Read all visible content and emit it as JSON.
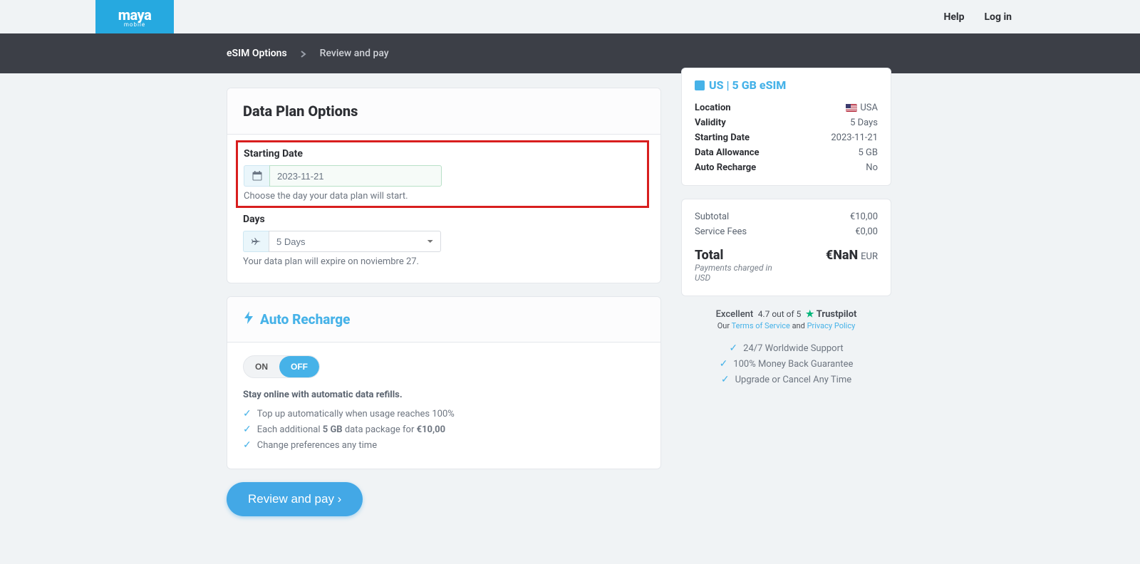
{
  "header": {
    "logo_main": "maya",
    "logo_sub": "mobile",
    "nav": {
      "help": "Help",
      "login": "Log in"
    }
  },
  "breadcrumb": {
    "step1": "eSIM Options",
    "step2": "Review and pay"
  },
  "data_plan": {
    "title": "Data Plan Options",
    "starting_date_label": "Starting Date",
    "starting_date_value": "2023-11-21",
    "starting_date_helper": "Choose the day your data plan will start.",
    "days_label": "Days",
    "days_value": "5 Days",
    "days_helper": "Your data plan will expire on noviembre 27."
  },
  "auto_recharge": {
    "title": "Auto Recharge",
    "on": "ON",
    "off": "OFF",
    "headline": "Stay online with automatic data refills.",
    "b1": "Top up automatically when usage reaches 100%",
    "b2a": "Each additional ",
    "b2b": "5 GB",
    "b2c": " data package for ",
    "b2d": "€10,00",
    "b3": "Change preferences any time"
  },
  "cta": {
    "review": "Review and pay ›"
  },
  "summary": {
    "title": "US | 5 GB eSIM",
    "rows": {
      "location_k": "Location",
      "location_v": "USA",
      "validity_k": "Validity",
      "validity_v": "5 Days",
      "start_k": "Starting Date",
      "start_v": "2023-11-21",
      "allowance_k": "Data Allowance",
      "allowance_v": "5 GB",
      "auto_k": "Auto Recharge",
      "auto_v": "No"
    }
  },
  "totals": {
    "subtotal_k": "Subtotal",
    "subtotal_v": "€10,00",
    "fees_k": "Service Fees",
    "fees_v": "€0,00",
    "total_k": "Total",
    "total_v": "€NaN",
    "currency": "EUR",
    "note": "Payments charged in USD"
  },
  "trust": {
    "excellent": "Excellent",
    "rating": "4.7 out of 5",
    "trustpilot": "Trustpilot",
    "our": "Our ",
    "tos": "Terms of Service",
    "and": " and ",
    "privacy": "Privacy Policy"
  },
  "perks": {
    "p1": "24/7 Worldwide Support",
    "p2": "100% Money Back Guarantee",
    "p3": "Upgrade or Cancel Any Time"
  }
}
